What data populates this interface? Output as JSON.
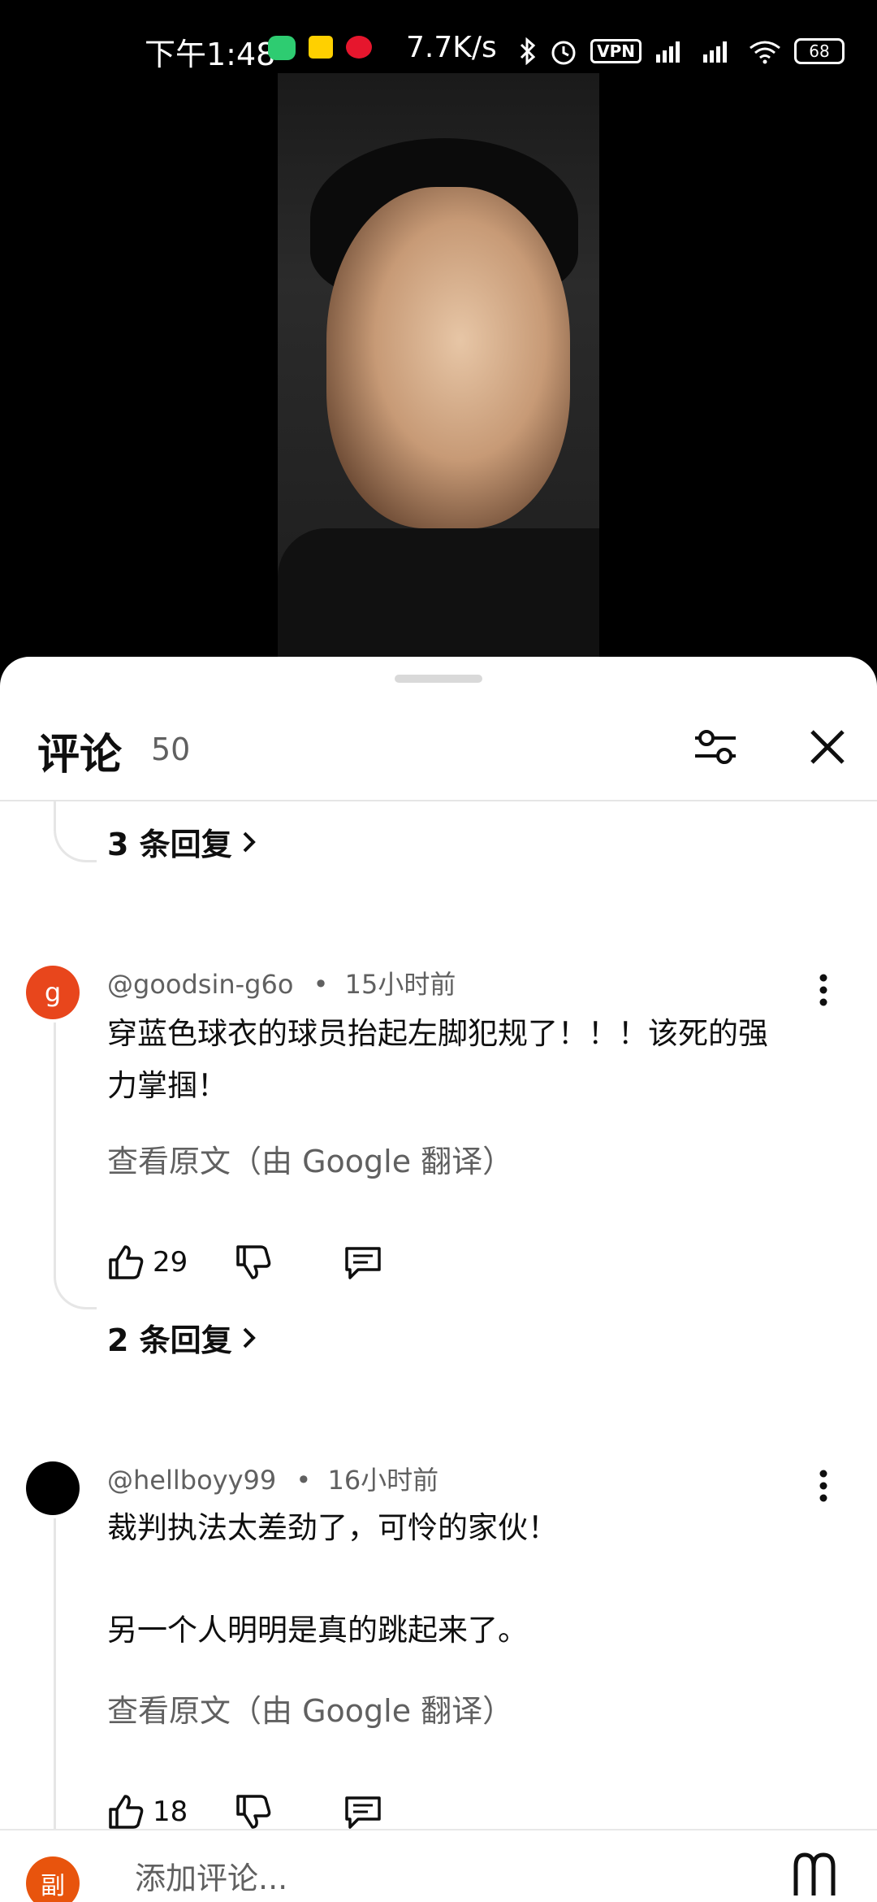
{
  "status_bar": {
    "time": "下午1:48",
    "net_speed": "7.7K/s",
    "vpn": "VPN",
    "battery": "68",
    "icons": [
      "wechat-icon",
      "meituan-icon",
      "weibo-icon",
      "bluetooth-icon",
      "alarm-icon",
      "signal-icon",
      "wifi-icon",
      "battery-icon"
    ]
  },
  "sheet": {
    "title": "评论",
    "count": "50"
  },
  "replies_1": "3 条回复",
  "comments": [
    {
      "avatar_letter": "g",
      "avatar_color": "#e8461c",
      "author": "@goodsin-g6o",
      "sep": "•",
      "time": "15小时前",
      "text_line1": "穿蓝色球衣的球员抬起左脚犯规了！！！该死的强",
      "text_line2": "力掌掴！",
      "translate": "查看原文（由 Google 翻译）",
      "likes": "29",
      "replies": "2 条回复"
    },
    {
      "avatar_color": "#000000",
      "author": "@hellboyy99",
      "sep": "•",
      "time": "16小时前",
      "text_line1": "裁判执法太差劲了，可怜的家伙！",
      "text_line2": "另一个人明明是真的跳起来了。",
      "translate": "查看原文（由 Google 翻译）",
      "likes": "18"
    }
  ],
  "composer": {
    "avatar_text": "副",
    "placeholder": "添加评论..."
  }
}
